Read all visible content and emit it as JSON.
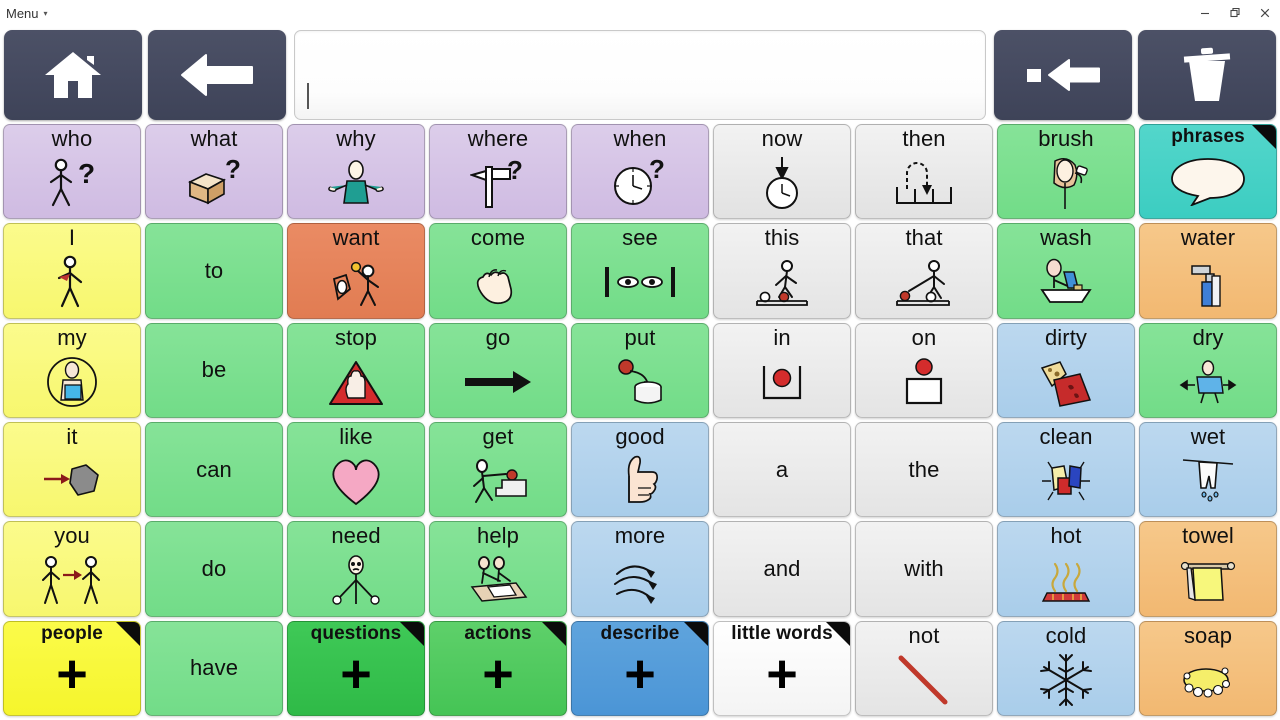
{
  "window": {
    "menu_label": "Menu",
    "menu_caret": "▾",
    "controls": {
      "minimize": "minimize-icon",
      "restore": "restore-icon",
      "close": "close-icon"
    }
  },
  "toolbar": {
    "home_icon": "home-icon",
    "back_icon": "back-arrow-icon",
    "backspace_icon": "backspace-icon",
    "clear_icon": "trash-icon",
    "message": {
      "value": "",
      "placeholder": ""
    }
  },
  "grid": {
    "columns": 9,
    "rows": 6,
    "buttons": [
      {
        "label": "who",
        "color": "c-question",
        "art": "person-question",
        "folder": false
      },
      {
        "label": "what",
        "color": "c-question",
        "art": "box-question",
        "folder": false
      },
      {
        "label": "why",
        "color": "c-question",
        "art": "shrug-person",
        "folder": false
      },
      {
        "label": "where",
        "color": "c-question",
        "art": "signpost-question",
        "folder": false
      },
      {
        "label": "when",
        "color": "c-question",
        "art": "clock-question",
        "folder": false
      },
      {
        "label": "now",
        "color": "c-time",
        "art": "clock-arrow",
        "folder": false
      },
      {
        "label": "then",
        "color": "c-time",
        "art": "sequence-arrow",
        "folder": false
      },
      {
        "label": "brush",
        "color": "c-verb",
        "art": "brush-hair",
        "folder": false
      },
      {
        "label": "phrases",
        "color": "c-phrases",
        "art": "speech-bubble",
        "folder": true
      },
      {
        "label": "I",
        "color": "c-pronoun",
        "art": "self-person",
        "folder": false
      },
      {
        "label": "to",
        "color": "c-verb",
        "art": "none",
        "folder": false
      },
      {
        "label": "want",
        "color": "c-highlight",
        "art": "want-person",
        "folder": false
      },
      {
        "label": "come",
        "color": "c-verb",
        "art": "beckon-hand",
        "folder": false
      },
      {
        "label": "see",
        "color": "c-verb",
        "art": "eyes",
        "folder": false
      },
      {
        "label": "this",
        "color": "c-little",
        "art": "this-pointing",
        "folder": false
      },
      {
        "label": "that",
        "color": "c-little",
        "art": "that-pointing",
        "folder": false
      },
      {
        "label": "wash",
        "color": "c-verb",
        "art": "wash-hands",
        "folder": false
      },
      {
        "label": "water",
        "color": "c-noun",
        "art": "tap-water",
        "folder": false
      },
      {
        "label": "my",
        "color": "c-pronoun",
        "art": "my-person",
        "folder": false
      },
      {
        "label": "be",
        "color": "c-verb",
        "art": "none",
        "folder": false
      },
      {
        "label": "stop",
        "color": "c-verb",
        "art": "stop-hand",
        "folder": false
      },
      {
        "label": "go",
        "color": "c-verb",
        "art": "right-arrow",
        "folder": false
      },
      {
        "label": "put",
        "color": "c-verb",
        "art": "put-object",
        "folder": false
      },
      {
        "label": "in",
        "color": "c-little",
        "art": "in-container",
        "folder": false
      },
      {
        "label": "on",
        "color": "c-little",
        "art": "on-surface",
        "folder": false
      },
      {
        "label": "dirty",
        "color": "c-describe",
        "art": "dirty-clothes",
        "folder": false
      },
      {
        "label": "dry",
        "color": "c-verb",
        "art": "dry-towel",
        "folder": false
      },
      {
        "label": "it",
        "color": "c-pronoun",
        "art": "arrow-blob",
        "folder": false
      },
      {
        "label": "can",
        "color": "c-verb",
        "art": "none",
        "folder": false
      },
      {
        "label": "like",
        "color": "c-verb",
        "art": "heart",
        "folder": false
      },
      {
        "label": "get",
        "color": "c-verb",
        "art": "get-object",
        "folder": false
      },
      {
        "label": "good",
        "color": "c-describe",
        "art": "thumbs-up",
        "folder": false
      },
      {
        "label": "a",
        "color": "c-little",
        "art": "none",
        "folder": false
      },
      {
        "label": "the",
        "color": "c-little",
        "art": "none",
        "folder": false
      },
      {
        "label": "clean",
        "color": "c-describe",
        "art": "clean-sparkle",
        "folder": false
      },
      {
        "label": "wet",
        "color": "c-describe",
        "art": "wet-clothes",
        "folder": false
      },
      {
        "label": "you",
        "color": "c-pronoun",
        "art": "two-people",
        "folder": false
      },
      {
        "label": "do",
        "color": "c-verb",
        "art": "none",
        "folder": false
      },
      {
        "label": "need",
        "color": "c-verb",
        "art": "need-person",
        "folder": false
      },
      {
        "label": "help",
        "color": "c-verb",
        "art": "help-people",
        "folder": false
      },
      {
        "label": "more",
        "color": "c-describe",
        "art": "more-swirl",
        "folder": false
      },
      {
        "label": "and",
        "color": "c-little",
        "art": "none",
        "folder": false
      },
      {
        "label": "with",
        "color": "c-little",
        "art": "none",
        "folder": false
      },
      {
        "label": "hot",
        "color": "c-describe",
        "art": "hot-steam",
        "folder": false
      },
      {
        "label": "towel",
        "color": "c-noun",
        "art": "towel-rail",
        "folder": false
      },
      {
        "label": "people",
        "color": "f-people",
        "art": "plus",
        "folder": true
      },
      {
        "label": "have",
        "color": "c-verb",
        "art": "none",
        "folder": false
      },
      {
        "label": "questions",
        "color": "f-questions",
        "art": "plus",
        "folder": true
      },
      {
        "label": "actions",
        "color": "f-actions",
        "art": "plus",
        "folder": true
      },
      {
        "label": "describe",
        "color": "f-describe",
        "art": "plus",
        "folder": true
      },
      {
        "label": "little words",
        "color": "f-little",
        "art": "plus",
        "folder": true
      },
      {
        "label": "not",
        "color": "c-little",
        "art": "red-slash",
        "folder": false
      },
      {
        "label": "cold",
        "color": "c-describe",
        "art": "snowflake",
        "folder": false
      },
      {
        "label": "soap",
        "color": "c-noun",
        "art": "soap-bar",
        "folder": false
      }
    ]
  },
  "palette": {
    "question": "#d3c2e6",
    "verb": "#7cdf90",
    "pronoun": "#f9f97c",
    "noun": "#f4c07e",
    "describe": "#b3d2ec",
    "little_words": "#ebebeb",
    "highlight": "#e5835b",
    "phrases": "#47d1c6",
    "nav_button": "#454a60",
    "folder_corner": "#0b0b0b"
  }
}
